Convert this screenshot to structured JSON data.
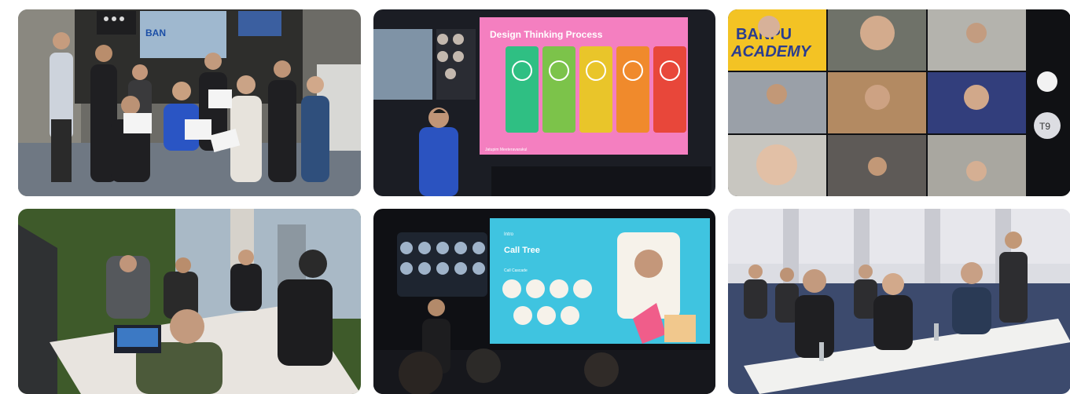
{
  "photos": [
    {
      "screen_logo": "BAN",
      "colors": {
        "wall": "#4c4b47",
        "floor": "#6f7883",
        "shirt_blue": "#2a55c4"
      }
    },
    {
      "slide_title": "Design Thinking Process",
      "presenter_caption": "Jatupim Meeteravarakul",
      "colors": {
        "slide_bg": "#f47fc0",
        "step1": "#2fbf83",
        "step2": "#7cc34a",
        "step3": "#e9c52a",
        "step4": "#f08a2c",
        "step5": "#e8473a"
      }
    },
    {
      "brand_line1": "BANPU",
      "brand_line2": "ACADEMY",
      "tile_badge": "T9",
      "colors": {
        "brand_bg": "#f3c324",
        "brand_text": "#2b3d8f"
      }
    },
    {
      "colors": {
        "wall_green": "#3e5a2a",
        "desk": "#e8e4df"
      }
    },
    {
      "slide_tag": "Intro",
      "slide_title": "Call Tree",
      "slide_subtitle": "Call Cascade",
      "colors": {
        "slide_bg": "#3fc4e0",
        "card_bg": "#f6f2ea",
        "megaphone": "#f05d8a"
      }
    },
    {
      "colors": {
        "wall": "#dcdde3",
        "table": "#f1f1ef"
      }
    }
  ]
}
